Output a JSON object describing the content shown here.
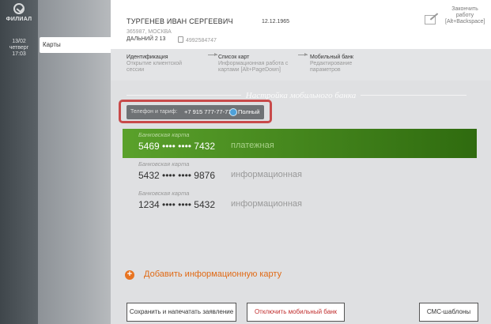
{
  "sidebar": {
    "logo_text": "ФИЛИАЛ",
    "date_line1": "13/02",
    "date_line2": "четверг",
    "time": "17:03"
  },
  "nav": {
    "active_item": "Карты"
  },
  "client": {
    "name": "ТУРГЕНЕВ ИВАН СЕРГЕЕВИЧ",
    "dob": "12.12.1965",
    "address_line": "365987, МОСКВА",
    "address_line2": "ДАЛЬНИЙ 2 13",
    "phone": "4992584747"
  },
  "header": {
    "finish_label_1": "Закончить",
    "finish_label_2": "работу",
    "finish_label_3": "[Alt+Backspace]",
    "pencil_icon": "pencil-icon"
  },
  "steps": [
    {
      "title": "Идентификация",
      "sub1": "Открытие клиентской",
      "sub2": "сессии"
    },
    {
      "title": "Список карт",
      "sub1": "Информационная работа с",
      "sub2": "картами [Alt+PageDown]"
    },
    {
      "title": "Мобильный банк",
      "sub1": "Редактирование",
      "sub2": "параметров"
    }
  ],
  "section": {
    "title": "Настройка мобильного банка"
  },
  "tariff": {
    "label": "Телефон и тариф:",
    "phone": "+7 915 777-77-77",
    "plan": "Полный",
    "highlight_color": "#c84a4a"
  },
  "cards": [
    {
      "label": "Банковская карта",
      "number": "5469 •••• •••• 7432",
      "type": "платежная",
      "active": true
    },
    {
      "label": "Банковская карта",
      "number": "5432 •••• •••• 9876",
      "type": "информационная",
      "active": false
    },
    {
      "label": "Банковская карта",
      "number": "1234 •••• •••• 5432",
      "type": "информационная",
      "active": false
    }
  ],
  "add_card": {
    "label": "Добавить информационную карту",
    "icon": "plus-circle-icon"
  },
  "buttons": {
    "save_print": "Сохранить и напечатать заявление",
    "disable": "Отключить мобильный банк",
    "sms": "СМС-шаблоны"
  },
  "colors": {
    "active_card_start": "#5aa12b",
    "active_card_end": "#2f6b0f",
    "accent_orange": "#e87421"
  }
}
